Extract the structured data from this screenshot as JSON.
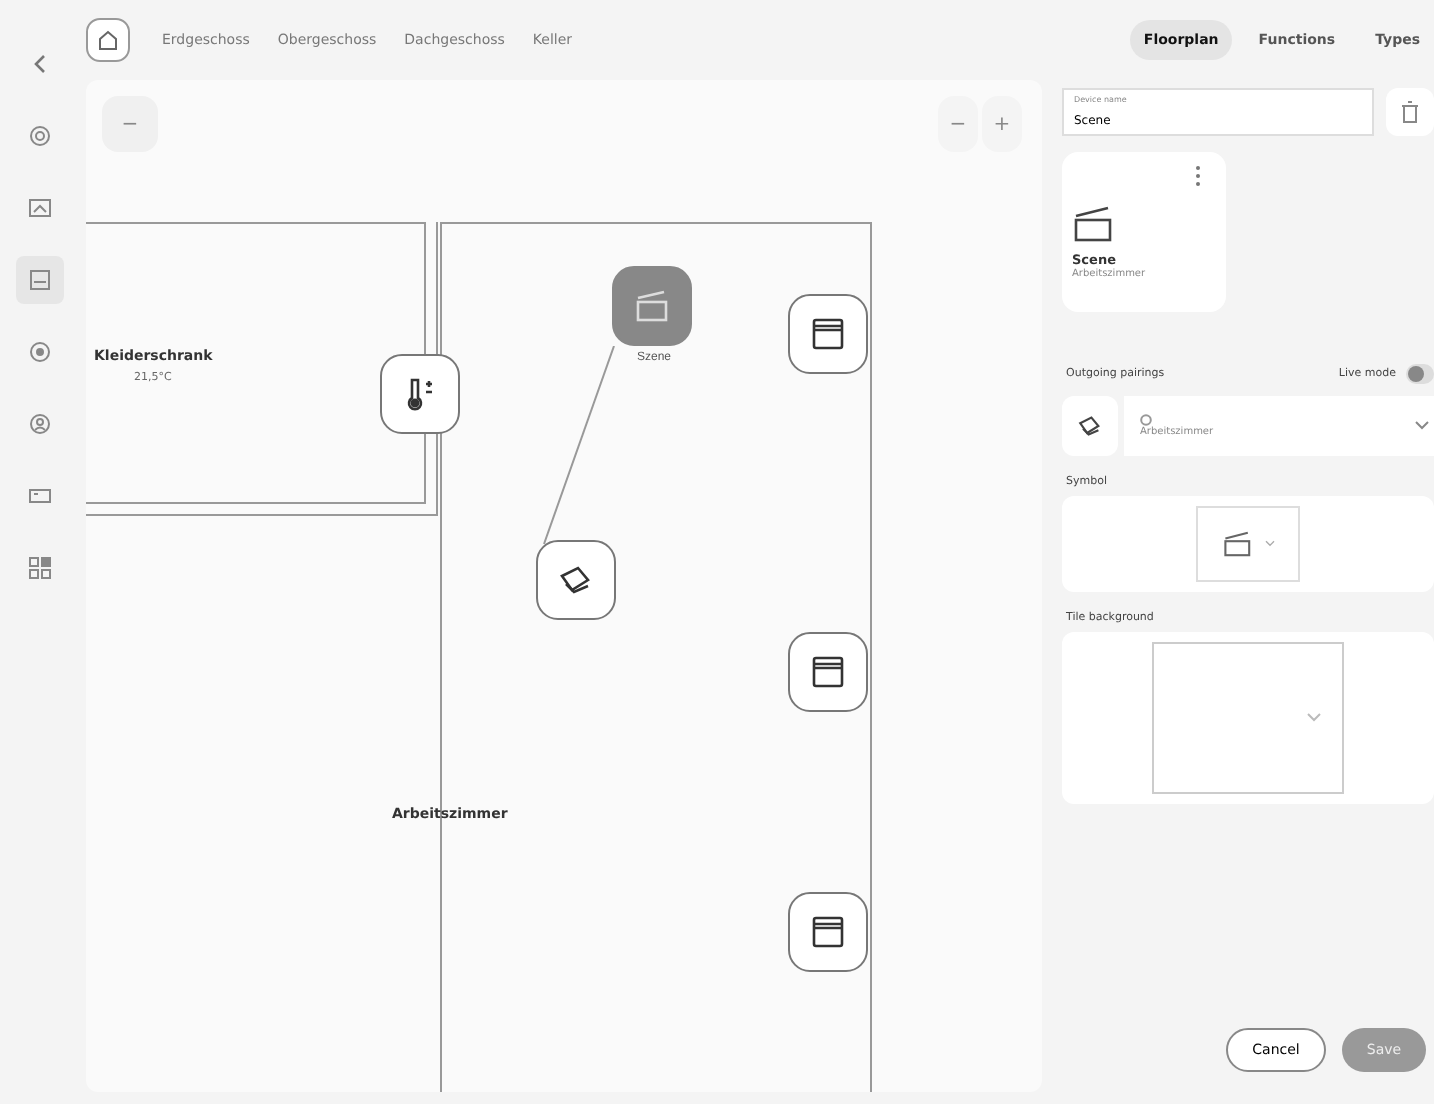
{
  "sidebar": {
    "items": [
      {
        "kind": "gear",
        "selected": false
      },
      {
        "kind": "image",
        "selected": false
      },
      {
        "kind": "floor",
        "selected": true
      },
      {
        "kind": "target",
        "selected": false
      },
      {
        "kind": "user",
        "selected": false
      },
      {
        "kind": "screen",
        "selected": false
      },
      {
        "kind": "blocks",
        "selected": false
      }
    ]
  },
  "floors": [
    {
      "label": "Erdgeschoss",
      "selected": false
    },
    {
      "label": "Obergeschoss",
      "selected": false
    },
    {
      "label": "Dachgeschoss",
      "selected": false
    },
    {
      "label": "Keller",
      "selected": false
    }
  ],
  "canvas": {
    "zoom_out": "−",
    "zoom_in": "+",
    "rooms": [
      {
        "name": "Kleiderschrank",
        "temperature": "21,5°C"
      },
      {
        "name": "Arbeitszimmer"
      }
    ],
    "devices": [
      {
        "kind": "thermostat",
        "selected": false
      },
      {
        "kind": "scene",
        "label": "Szene",
        "selected": true
      },
      {
        "kind": "pairing",
        "selected": false
      },
      {
        "kind": "shutter",
        "selected": false
      },
      {
        "kind": "shutter",
        "selected": false
      },
      {
        "kind": "shutter",
        "selected": false
      }
    ]
  },
  "panel": {
    "tabs": [
      {
        "label": "Floorplan",
        "selected": true
      },
      {
        "label": "Functions",
        "selected": false
      },
      {
        "label": "Types",
        "selected": false
      }
    ],
    "device_name": {
      "label": "Device name",
      "value": "Scene"
    },
    "card": {
      "title": "Scene",
      "room": "Arbeitszimmer"
    },
    "pairings_title": "Outgoing pairings",
    "live_mode": {
      "label": "Live mode",
      "on": false
    },
    "pairing": {
      "room": "Arbeitszimmer"
    },
    "symbol_title": "Symbol",
    "background_title": "Tile background",
    "buttons": {
      "cancel": "Cancel",
      "save": "Save"
    }
  }
}
